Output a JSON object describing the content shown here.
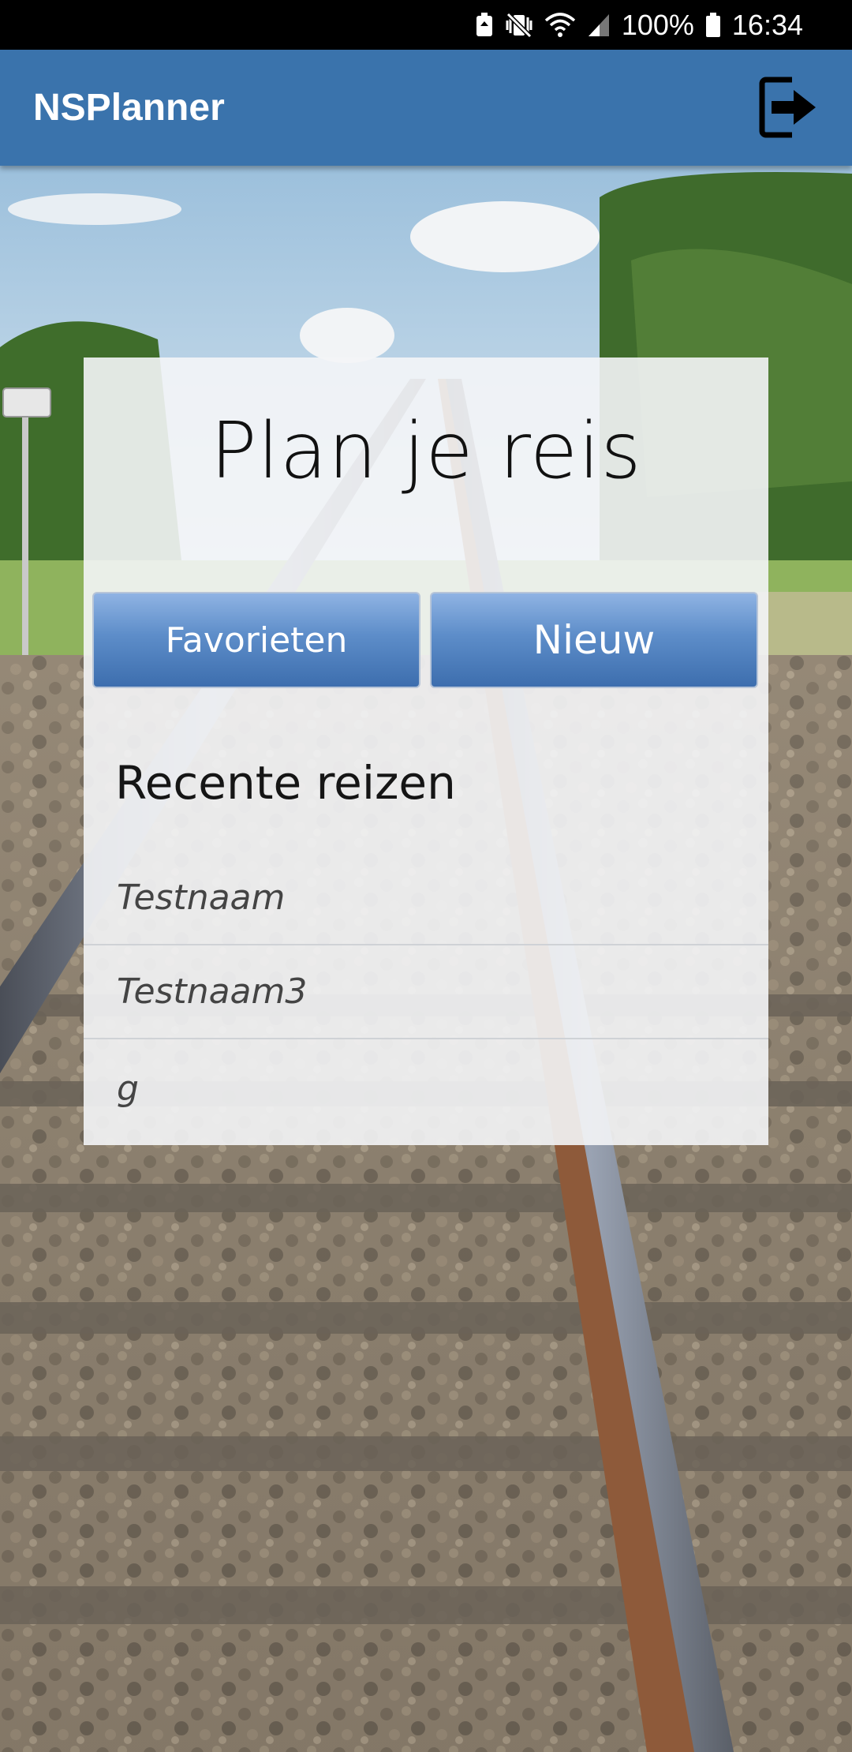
{
  "status_bar": {
    "battery_percent": "100%",
    "time": "16:34",
    "icons": [
      "battery-saver-icon",
      "vibrate-icon",
      "wifi-icon",
      "signal-icon",
      "battery-icon"
    ]
  },
  "app_bar": {
    "title": "NSPlanner",
    "logout_icon": "logout-icon",
    "color": "#3a73ac"
  },
  "card": {
    "title": "Plan je reis",
    "buttons": {
      "favorites": "Favorieten",
      "new": "Nieuw"
    },
    "recent_title": "Recente reizen",
    "recent_trips": [
      "Testnaam",
      "Testnaam3",
      "g"
    ]
  }
}
